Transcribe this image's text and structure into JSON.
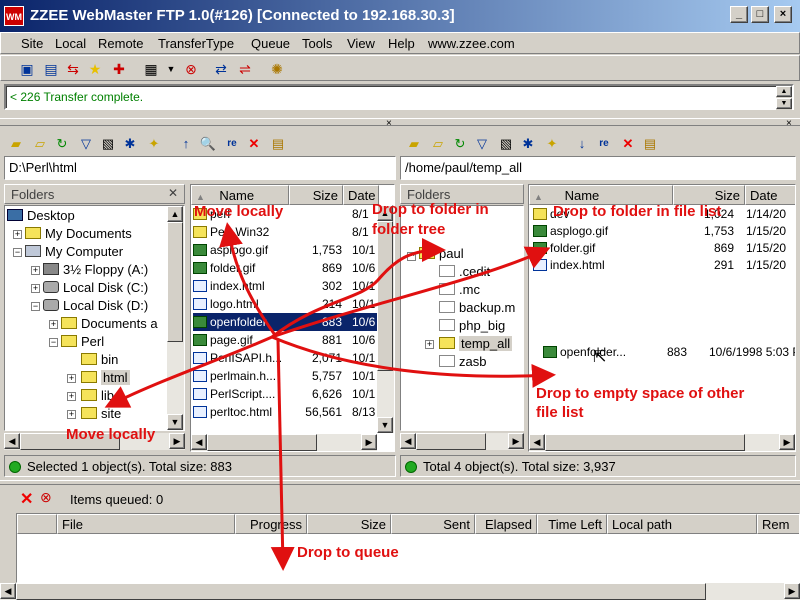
{
  "window": {
    "app_icon": "WM",
    "title": "ZZEE WebMaster FTP 1.0(#126) [Connected to 192.168.30.3]",
    "minimize": "_",
    "maximize": "□",
    "close": "×"
  },
  "menu": [
    "Site",
    "Local",
    "Remote",
    "TransferType",
    "Queue",
    "Tools",
    "View",
    "Help",
    "www.zzee.com"
  ],
  "log": {
    "line": "< 226 Transfer complete."
  },
  "local": {
    "path": "D:\\Perl\\html",
    "folders_header": "Folders",
    "tree": [
      "Desktop",
      "My Documents",
      "My Computer",
      "3½ Floppy (A:)",
      "Local Disk (C:)",
      "Local Disk (D:)",
      "Documents a",
      "Perl",
      "bin",
      "html",
      "lib",
      "site"
    ],
    "columns": [
      "Name",
      "Size",
      "Date"
    ],
    "files": [
      {
        "name": "perl",
        "size": "",
        "date": "8/1"
      },
      {
        "name": "Perl-Win32",
        "size": "",
        "date": "8/1"
      },
      {
        "name": "asplogo.gif",
        "size": "1,753",
        "date": "10/1"
      },
      {
        "name": "folder.gif",
        "size": "869",
        "date": "10/6"
      },
      {
        "name": "index.html",
        "size": "302",
        "date": "10/1"
      },
      {
        "name": "logo.html",
        "size": "214",
        "date": "10/1"
      },
      {
        "name": "openfolder",
        "size": "883",
        "date": "10/6"
      },
      {
        "name": "page.gif",
        "size": "881",
        "date": "10/6"
      },
      {
        "name": "PerlISAPI.h...",
        "size": "2,071",
        "date": "10/1"
      },
      {
        "name": "perlmain.h...",
        "size": "5,757",
        "date": "10/1"
      },
      {
        "name": "PerlScript....",
        "size": "6,626",
        "date": "10/1"
      },
      {
        "name": "perltoc.html",
        "size": "56,561",
        "date": "8/13"
      }
    ],
    "status": "Selected 1 object(s). Total size: 883"
  },
  "remote": {
    "path": "/home/paul/temp_all",
    "folders_header": "Folders",
    "tree": [
      "paul",
      ".cedit",
      ".mc",
      "backup.m",
      "php_big",
      "temp_all",
      "zasb"
    ],
    "columns": [
      "Name",
      "Size",
      "Date"
    ],
    "files": [
      {
        "name": "dev",
        "size": "1,024",
        "date": "1/14/20"
      },
      {
        "name": "asplogo.gif",
        "size": "1,753",
        "date": "1/15/20"
      },
      {
        "name": "folder.gif",
        "size": "869",
        "date": "1/15/20"
      },
      {
        "name": "index.html",
        "size": "291",
        "date": "1/15/20"
      }
    ],
    "drag_item": {
      "name": "openfolder...",
      "size": "883",
      "date": "10/6/1998 5:03 P"
    },
    "status": "Total 4 object(s). Total size: 3,937"
  },
  "queue": {
    "items_label": "Items queued: 0",
    "columns": [
      "File",
      "Progress",
      "Size",
      "Sent",
      "Elapsed",
      "Time Left",
      "Local path",
      "Rem"
    ]
  },
  "annotations": {
    "move_locally_1": "Move locally",
    "drop_folder_tree_1": "Drop to folder in",
    "drop_folder_tree_2": "folder tree",
    "drop_file_list": "Drop to folder in file list",
    "drop_empty_1": "Drop to empty space of other",
    "drop_empty_2": "file list",
    "move_locally_2": "Move locally",
    "drop_queue": "Drop to queue"
  },
  "colors": {
    "annotation": "#e01010",
    "selection": "#0a246a",
    "log_text": "#008000",
    "title_start": "#0a246a",
    "title_end": "#a6caf0"
  }
}
